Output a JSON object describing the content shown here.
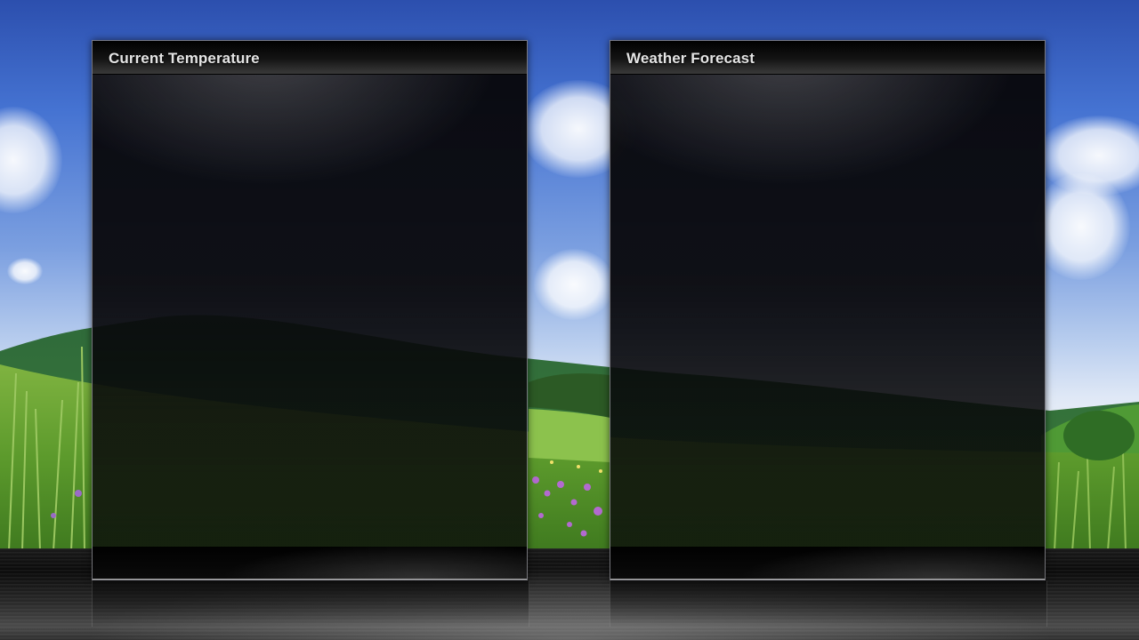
{
  "panels": {
    "current_temperature": {
      "title": "Current Temperature"
    },
    "weather_forecast": {
      "title": "Weather Forecast"
    }
  },
  "background": {
    "sky_color": "#4573d2",
    "grass_color": "#4f8f2c",
    "floor_color": "#1a1a1a"
  }
}
